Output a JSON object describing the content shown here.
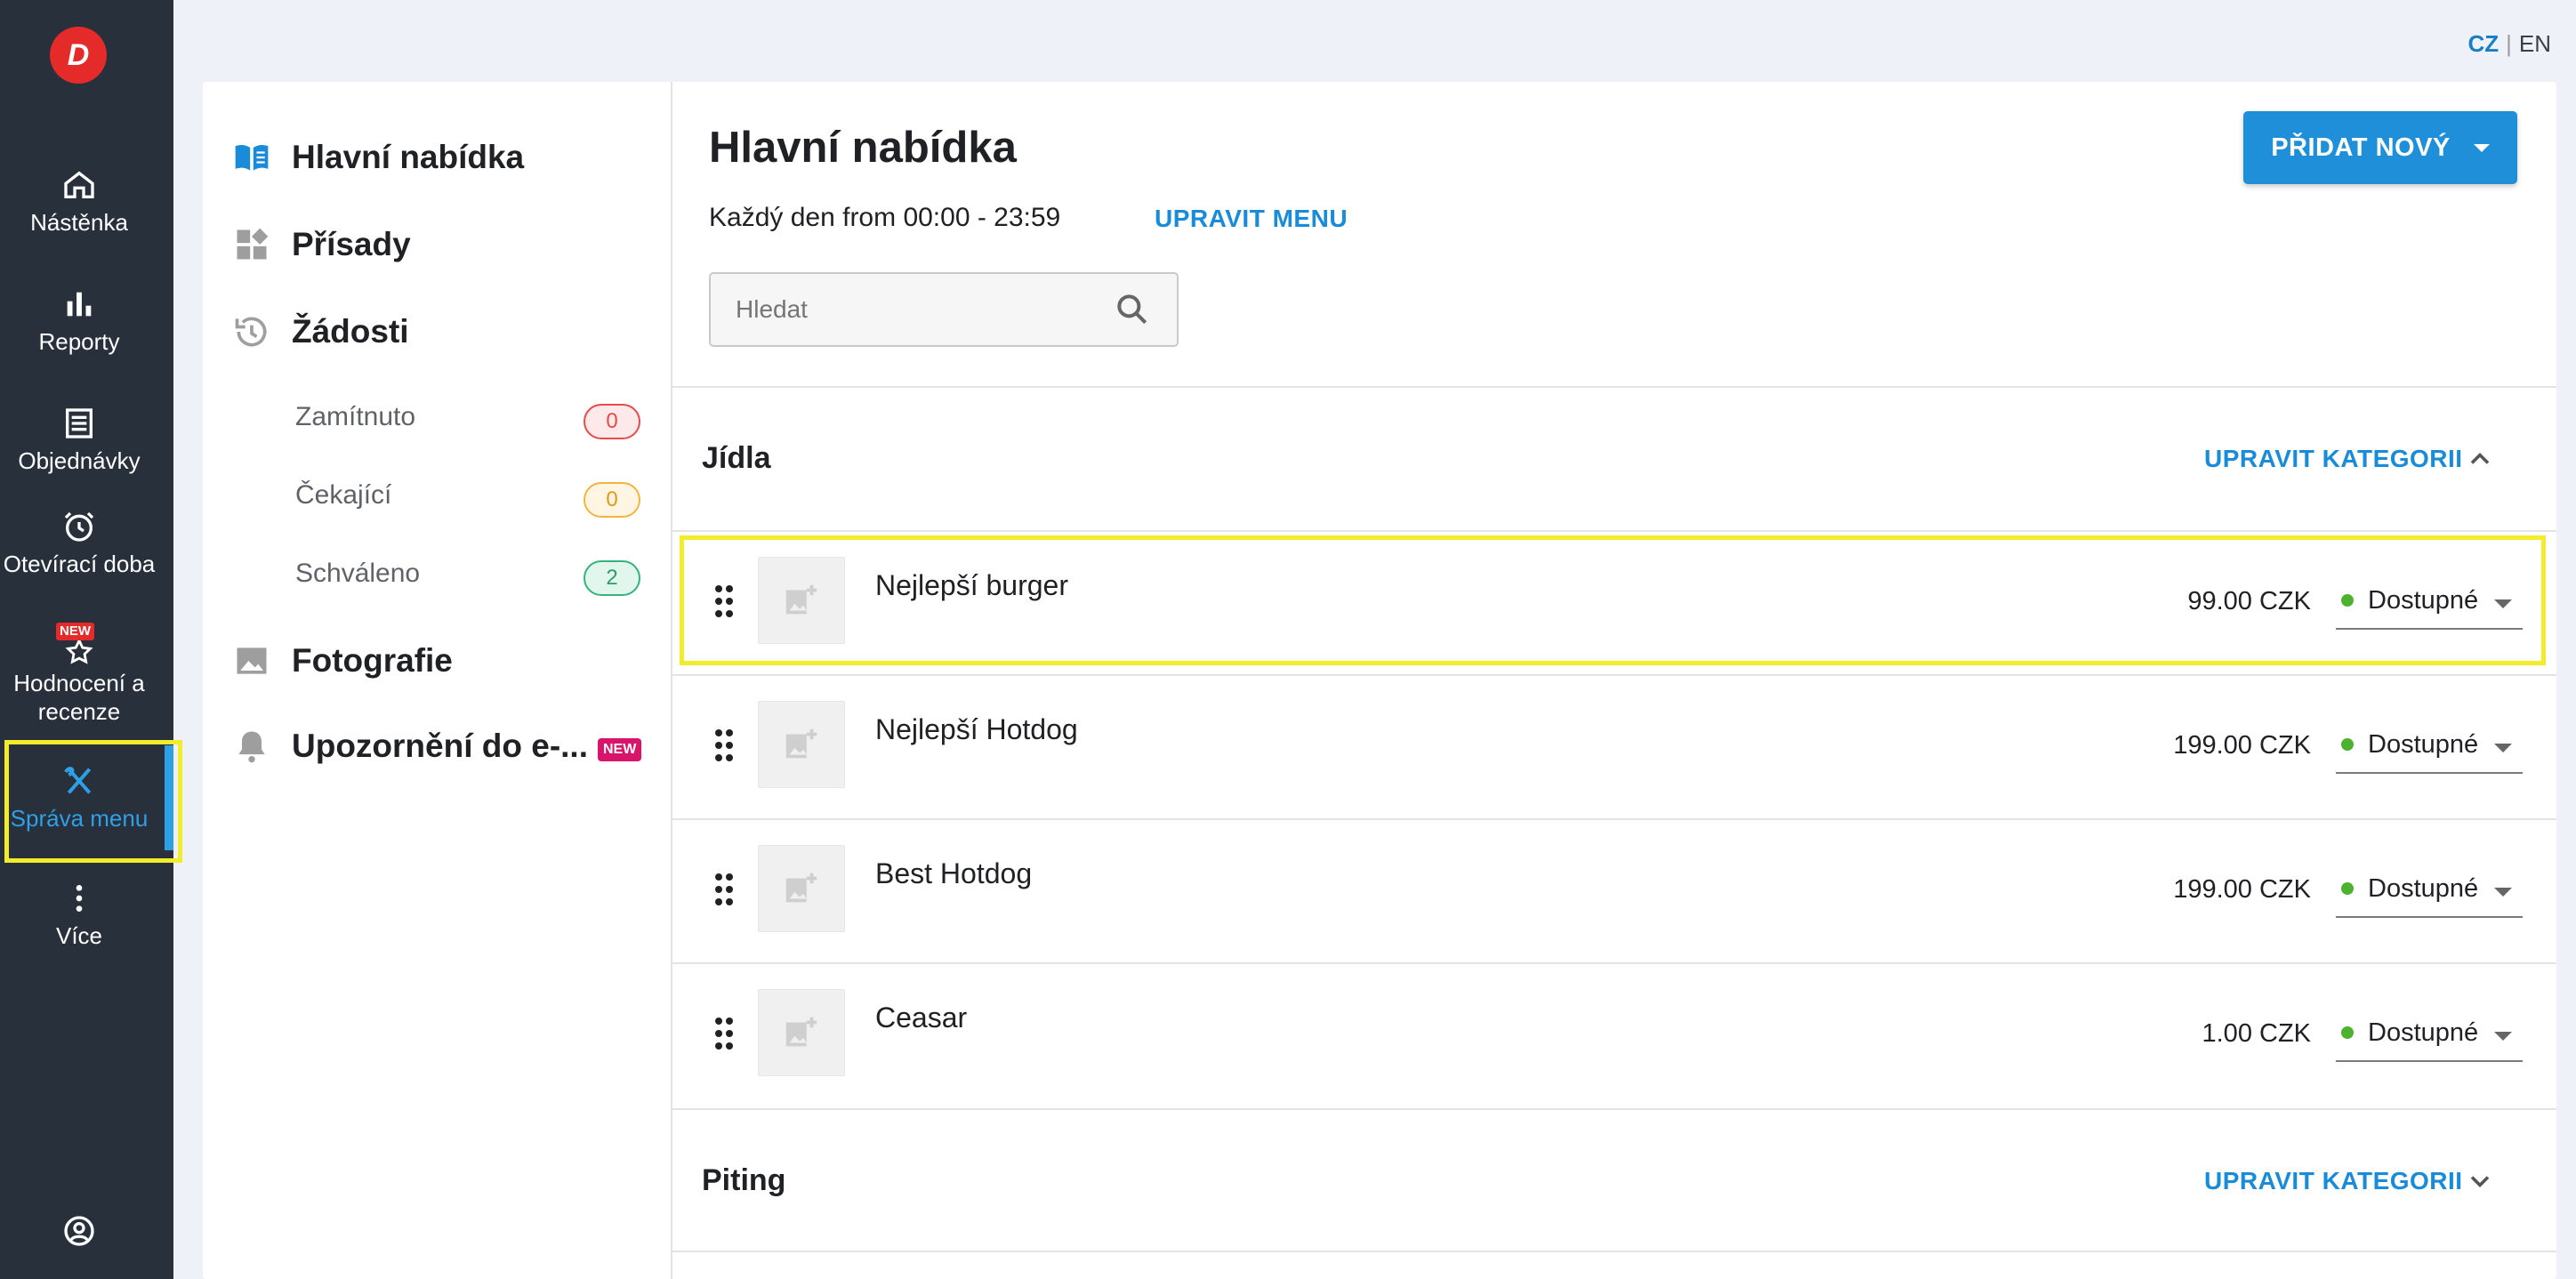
{
  "nav": {
    "logo": "D",
    "items": [
      {
        "label": "Nástěnka",
        "icon": "home-icon"
      },
      {
        "label": "Reporty",
        "icon": "bar-chart-icon"
      },
      {
        "label": "Objednávky",
        "icon": "orders-icon"
      },
      {
        "label": "Otevírací doba",
        "icon": "alarm-clock-icon"
      },
      {
        "label": "Hodnocení a recenze",
        "icon": "star-icon",
        "badge": "NEW"
      },
      {
        "label": "Správa menu",
        "icon": "cutlery-icon",
        "active": true
      },
      {
        "label": "Více",
        "icon": "more-vertical-icon"
      }
    ],
    "bottom_icon": "account-circle-icon"
  },
  "lang": {
    "cz": "CZ",
    "en": "EN",
    "active": "CZ"
  },
  "sub": {
    "items": [
      {
        "label": "Hlavní nabídka",
        "icon": "menu-book-icon"
      },
      {
        "label": "Přísady",
        "icon": "widgets-icon"
      },
      {
        "label": "Žádosti",
        "icon": "history-icon"
      },
      {
        "label": "Fotografie",
        "icon": "image-icon"
      },
      {
        "label": "Upozornění do e-...",
        "icon": "bell-icon",
        "badge": "NEW"
      }
    ],
    "requests": [
      {
        "label": "Zamítnuto",
        "count": "0",
        "color": "#e84a4a"
      },
      {
        "label": "Čekající",
        "count": "0",
        "color": "#f5b43e"
      },
      {
        "label": "Schváleno",
        "count": "2",
        "color": "#34b37a"
      }
    ]
  },
  "main": {
    "title": "Hlavní nabídka",
    "schedule": "Každý den from 00:00 - 23:59",
    "edit_menu": "UPRAVIT MENU",
    "add_new": "PŘIDAT NOVÝ",
    "search_placeholder": "Hledat",
    "categories": [
      {
        "name": "Jídla",
        "edit": "UPRAVIT KATEGORII",
        "expanded": true,
        "items": [
          {
            "name": "Nejlepší burger",
            "price": "99.00 CZK",
            "status": "Dostupné"
          },
          {
            "name": "Nejlepší Hotdog",
            "price": "199.00 CZK",
            "status": "Dostupné"
          },
          {
            "name": "Best Hotdog",
            "price": "199.00 CZK",
            "status": "Dostupné"
          },
          {
            "name": "Ceasar",
            "price": "1.00 CZK",
            "status": "Dostupné"
          }
        ]
      },
      {
        "name": "Piting",
        "edit": "UPRAVIT KATEGORII",
        "expanded": false
      }
    ]
  },
  "colors": {
    "nav_bg": "#28303c",
    "accent": "#1f8fda",
    "highlight": "#f3ec2b",
    "available": "#4fb22f"
  }
}
